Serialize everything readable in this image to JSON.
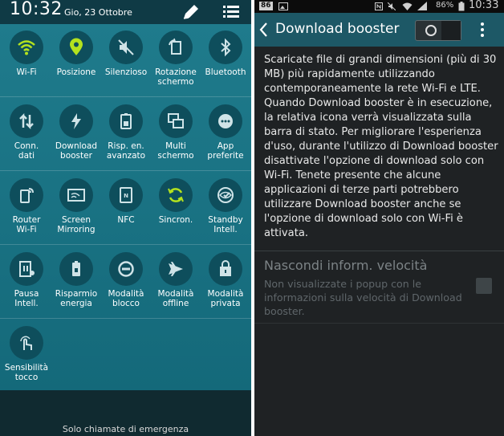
{
  "left_panel": {
    "status_bar": {
      "time": "10:32",
      "date": "Gio, 23 Ottobre"
    },
    "tiles": [
      {
        "label": "Wi-Fi",
        "icon": "wifi-icon",
        "active": true
      },
      {
        "label": "Posizione",
        "icon": "location-icon",
        "active": true
      },
      {
        "label": "Silenzioso",
        "icon": "mute-icon",
        "active": false
      },
      {
        "label": "Rotazione\nschermo",
        "icon": "rotate-screen-icon",
        "active": false
      },
      {
        "label": "Bluetooth",
        "icon": "bluetooth-icon",
        "active": false
      },
      {
        "label": "Conn.\ndati",
        "icon": "mobile-data-icon",
        "active": false
      },
      {
        "label": "Download\nbooster",
        "icon": "download-booster-icon",
        "active": false
      },
      {
        "label": "Risp. en.\navanzato",
        "icon": "ultra-power-saving-icon",
        "active": false
      },
      {
        "label": "Multi\nschermo",
        "icon": "multi-window-icon",
        "active": false
      },
      {
        "label": "App\npreferite",
        "icon": "favorite-apps-icon",
        "active": false
      },
      {
        "label": "Router\nWi-Fi",
        "icon": "wifi-hotspot-icon",
        "active": false
      },
      {
        "label": "Screen\nMirroring",
        "icon": "screen-mirroring-icon",
        "active": false
      },
      {
        "label": "NFC",
        "icon": "nfc-icon",
        "active": false
      },
      {
        "label": "Sincron.",
        "icon": "sync-icon",
        "active": true
      },
      {
        "label": "Standby\nIntell.",
        "icon": "smart-stay-icon",
        "active": false
      },
      {
        "label": "Pausa\nIntell.",
        "icon": "smart-pause-icon",
        "active": false
      },
      {
        "label": "Risparmio\nenergia",
        "icon": "power-saving-icon",
        "active": false
      },
      {
        "label": "Modalità\nblocco",
        "icon": "blocking-mode-icon",
        "active": false
      },
      {
        "label": "Modalità\noffline",
        "icon": "airplane-icon",
        "active": false
      },
      {
        "label": "Modalità\nprivata",
        "icon": "private-mode-icon",
        "active": false
      },
      {
        "label": "Sensibilità\ntocco",
        "icon": "touch-sensitivity-icon",
        "active": false
      }
    ],
    "emergency_text": "Solo chiamate di emergenza"
  },
  "right_panel": {
    "status_bar": {
      "badge": "86",
      "battery": "86%",
      "time": "10:33"
    },
    "header": {
      "title": "Download booster"
    },
    "description": "Scaricate file di grandi dimensioni (più di 30 MB) più rapidamente utilizzando contemporaneamente la rete Wi-Fi e LTE. Quando Download booster è in esecuzione, la relativa icona verrà visualizzata sulla barra di stato. Per migliorare l'esperienza d'uso, durante l'utilizzo di Download booster disattivate l'opzione di download solo con Wi-Fi. Tenete presente che alcune applicazioni di terze parti potrebbero utilizzare Download booster anche se l'opzione di download solo con Wi-Fi è attivata.",
    "option": {
      "title": "Nascondi inform. velocità",
      "description": "Non visualizzate i popup con le informazioni sulla velocità di Download booster."
    }
  },
  "colors": {
    "tile_active": "#b4e21e",
    "tile_inactive": "#cfe3e7",
    "header_bg": "#1d5866"
  }
}
